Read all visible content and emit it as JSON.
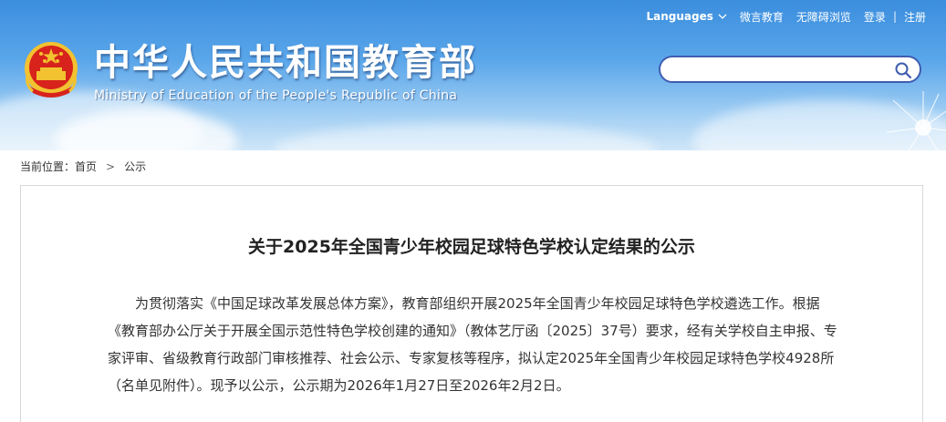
{
  "header": {
    "title_cn": "中华人民共和国教育部",
    "title_en": "Ministry of Education of the People's Republic of China",
    "top_links": {
      "languages": "Languages",
      "weiyan": "微言教育",
      "accessible": "无障碍浏览",
      "login": "登录",
      "divider": "|",
      "register": "注册"
    },
    "search": {
      "value": "",
      "placeholder": ""
    }
  },
  "breadcrumb": {
    "prefix": "当前位置：",
    "home": "首页",
    "separator": ">",
    "current": "公示"
  },
  "article": {
    "title": "关于2025年全国青少年校园足球特色学校认定结果的公示",
    "paragraph": "为贯彻落实《中国足球改革发展总体方案》，教育部组织开展2025年全国青少年校园足球特色学校遴选工作。根据《教育部办公厅关于开展全国示范性特色学校创建的通知》（教体艺厅函〔2025〕37号）要求，经有关学校自主申报、专家评审、省级教育行政部门审核推荐、社会公示、专家复核等程序，拟认定2025年全国青少年校园足球特色学校4928所（名单见附件）。现予以公示，公示期为2026年1月27日至2026年2月2日。"
  },
  "icons": {
    "emblem": "national-emblem-icon",
    "search": "search-icon",
    "languages_dropdown": "chevron-down-icon"
  },
  "colors": {
    "header_top": "#3b8ede",
    "search_border": "#3f5db0",
    "emblem_red": "#d7231b",
    "emblem_gold": "#f2c230"
  }
}
